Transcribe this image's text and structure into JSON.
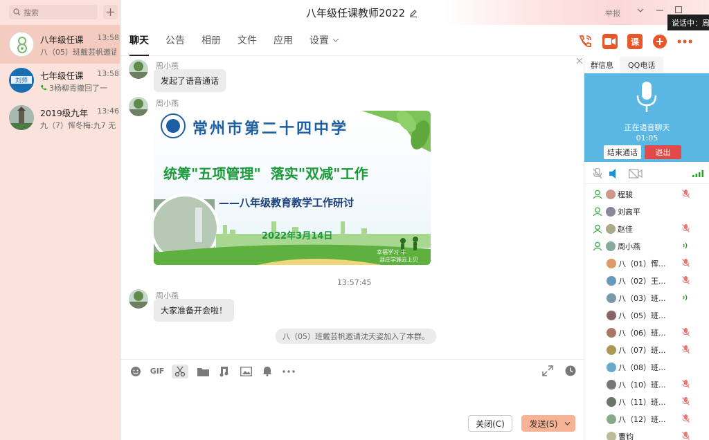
{
  "sidebar": {
    "search_placeholder": "搜索",
    "conversations": [
      {
        "name": "八年级任课",
        "time": "13:58",
        "preview": "八（05）班戴芸帆邀请",
        "selected": true
      },
      {
        "name": "七年级任课",
        "time": "13:58",
        "preview": "3杨柳青撤回了一"
      },
      {
        "name": "2019级九年",
        "time": "13:46",
        "preview": "九（7）恽冬梅:九7 无"
      }
    ]
  },
  "header": {
    "title": "八年级任课教师2022",
    "report_label": "举报",
    "tooltip": "说话中：周"
  },
  "tabs": [
    {
      "label": "聊天",
      "active": true
    },
    {
      "label": "公告"
    },
    {
      "label": "相册"
    },
    {
      "label": "文件"
    },
    {
      "label": "应用"
    },
    {
      "label": "设置"
    }
  ],
  "toolbar_icons": {
    "lesson_label": "课"
  },
  "messages": [
    {
      "sender": "周小燕",
      "text": "发起了语音通话"
    },
    {
      "sender": "周小燕",
      "type": "image"
    },
    {
      "sender": "周小燕",
      "text": "大家准备开会啦！"
    }
  ],
  "timestamp": "13:57:45",
  "system_message": "八（05）班戴芸帆邀请沈天姿加入了本群。",
  "poster": {
    "school": "常州市第二十四中学",
    "headline": "统筹\"五项管理\"  落实\"双减\"工作",
    "subtitle": "——八年级教育教学工作研讨",
    "date": "2022年3月14日",
    "corner_text_1": "幸福学习 牛",
    "corner_text_2": "涯庄学施云上贝"
  },
  "input": {
    "gif_label": "GIF",
    "close_button": "关闭(C)",
    "send_button": "发送(S)"
  },
  "right_panel": {
    "tabs": [
      "群信息",
      "QQ电话"
    ],
    "voice_status": "正在语音聊天",
    "voice_time": "01:05",
    "end_call": "结束通话",
    "exit": "退出",
    "members": [
      {
        "name": "程骏",
        "speaking": false,
        "muted": true,
        "host": true
      },
      {
        "name": "刘高平",
        "speaking": false,
        "muted": false,
        "host": true
      },
      {
        "name": "赵佳",
        "speaking": false,
        "muted": true,
        "host": true
      },
      {
        "name": "周小燕",
        "speaking": true,
        "muted": false,
        "host": true
      },
      {
        "name": "八（01）恽...",
        "speaking": false,
        "muted": true
      },
      {
        "name": "八（02）王...",
        "speaking": false,
        "muted": true
      },
      {
        "name": "八（03）班...",
        "speaking": true,
        "muted": false
      },
      {
        "name": "八（05）班...",
        "speaking": false,
        "muted": false
      },
      {
        "name": "八（06）班...",
        "speaking": false,
        "muted": true
      },
      {
        "name": "八（07）班...",
        "speaking": false,
        "muted": true
      },
      {
        "name": "八（08）班...",
        "speaking": false,
        "muted": false
      },
      {
        "name": "八（10）班...",
        "speaking": false,
        "muted": true
      },
      {
        "name": "八（11）班...",
        "speaking": false,
        "muted": true
      },
      {
        "name": "八（12）班...",
        "speaking": false,
        "muted": true
      },
      {
        "name": "曹钧",
        "speaking": false,
        "muted": true
      }
    ]
  },
  "colors": {
    "accent_orange": "#e8572a",
    "voice_blue": "#5ab7e4",
    "exit_red": "#e24a4a",
    "send_bg": "#f6b395"
  }
}
